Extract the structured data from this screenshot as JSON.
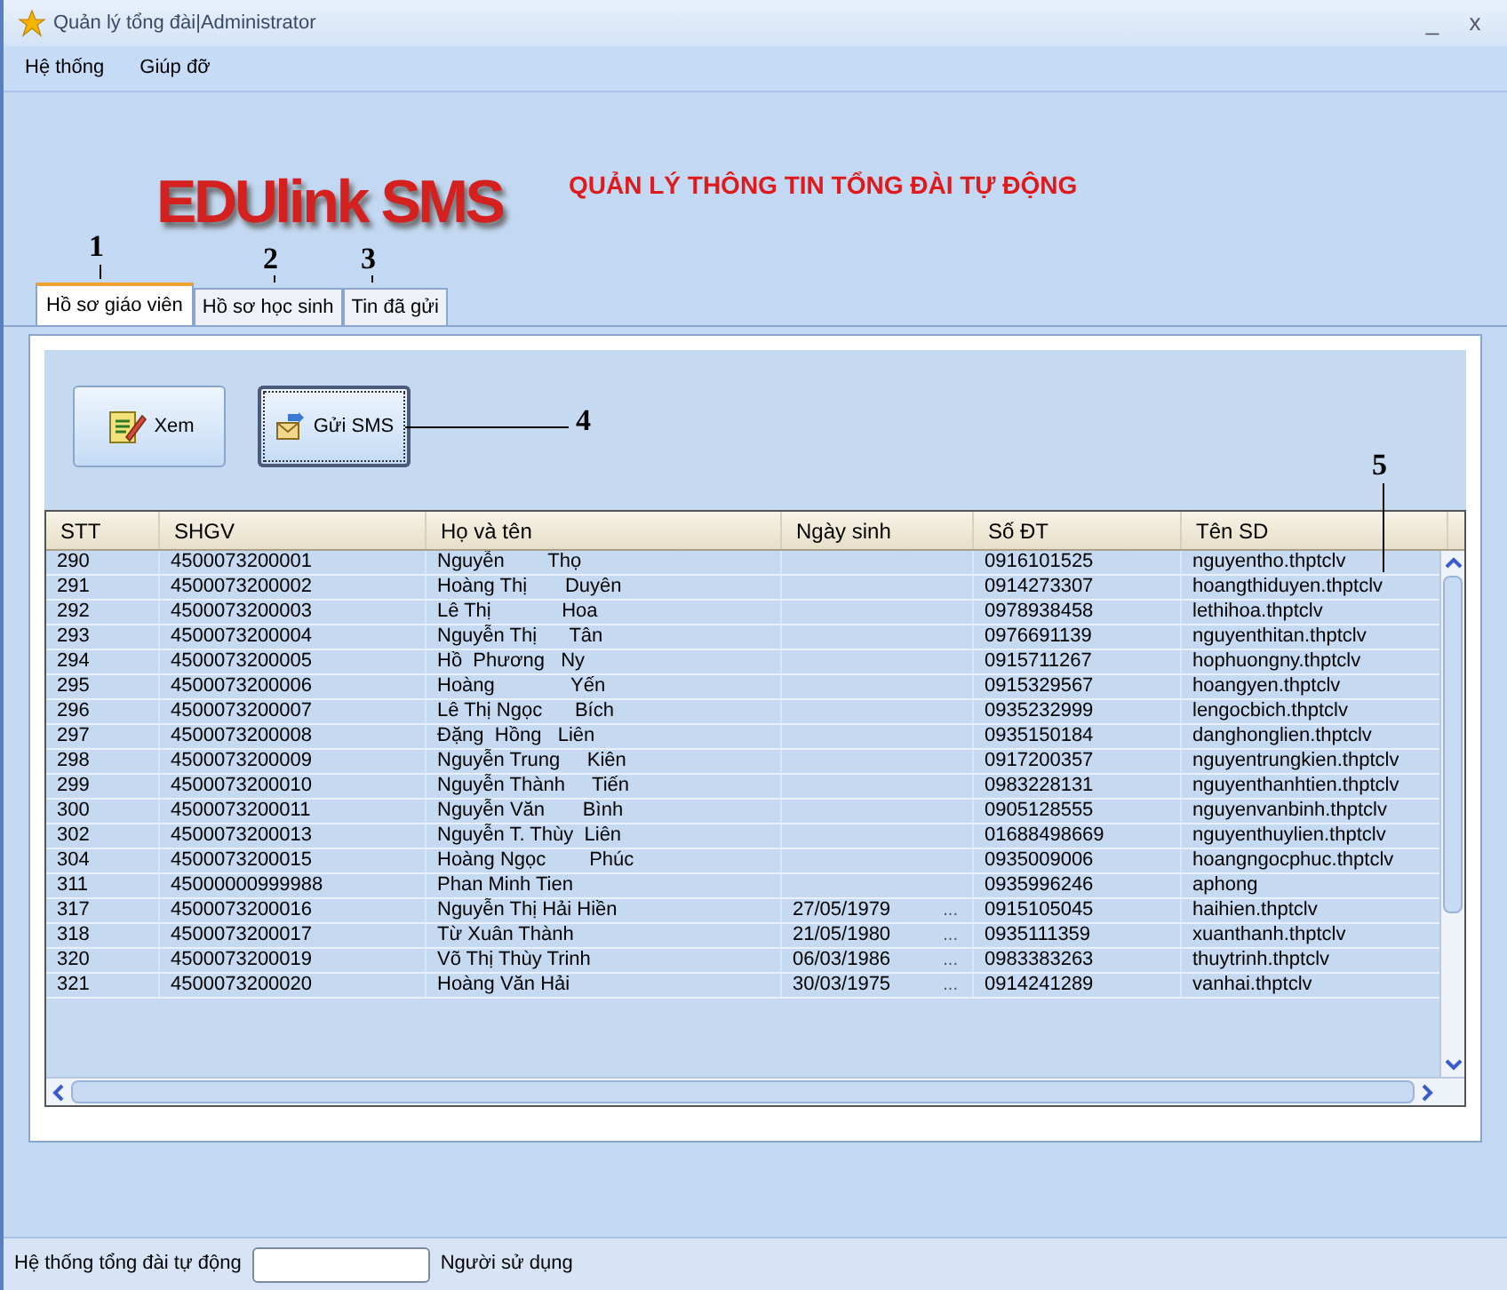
{
  "window": {
    "title": "Quản lý tổng đài|Administrator",
    "controls": [
      "_",
      "x"
    ]
  },
  "menu": [
    "Hệ thống",
    "Giúp đỡ"
  ],
  "header": {
    "logo": "EDUlink SMS",
    "title": "QUẢN LÝ THÔNG TIN TỔNG ĐÀI TỰ ĐỘNG"
  },
  "tabs": [
    {
      "label": "Hồ sơ giáo viên",
      "selected": true
    },
    {
      "label": "Hồ sơ học sinh",
      "selected": false
    },
    {
      "label": "Tin đã gửi",
      "selected": false
    }
  ],
  "toolbar": [
    {
      "label": "Xem",
      "kind": "view",
      "focused": false
    },
    {
      "label": "Gửi SMS",
      "kind": "send",
      "focused": true
    }
  ],
  "table": {
    "columns": [
      "STT",
      "SHGV",
      "Họ và tên",
      "Ngày sinh",
      "Số ĐT",
      "Tên SD"
    ],
    "rows": [
      [
        "290",
        "4500073200001",
        "Nguyễn        Thọ",
        "",
        "0916101525",
        "nguyentho.thptclv"
      ],
      [
        "291",
        "4500073200002",
        "Hoàng Thị       Duyên",
        "",
        "0914273307",
        "hoangthiduyen.thptclv"
      ],
      [
        "292",
        "4500073200003",
        "Lê Thị             Hoa",
        "",
        "0978938458",
        "lethihoa.thptclv"
      ],
      [
        "293",
        "4500073200004",
        "Nguyễn Thị      Tân",
        "",
        "0976691139",
        "nguyenthitan.thptclv"
      ],
      [
        "294",
        "4500073200005",
        "Hồ  Phương   Ny",
        "",
        "0915711267",
        "hophuongny.thptclv"
      ],
      [
        "295",
        "4500073200006",
        "Hoàng              Yến",
        "",
        "0915329567",
        "hoangyen.thptclv"
      ],
      [
        "296",
        "4500073200007",
        "Lê Thị Ngọc      Bích",
        "",
        "0935232999",
        "lengocbich.thptclv"
      ],
      [
        "297",
        "4500073200008",
        "Đặng  Hồng   Liên",
        "",
        "0935150184",
        "danghonglien.thptclv"
      ],
      [
        "298",
        "4500073200009",
        "Nguyễn Trung     Kiên",
        "",
        "0917200357",
        "nguyentrungkien.thptclv"
      ],
      [
        "299",
        "4500073200010",
        "Nguyễn Thành     Tiến",
        "",
        "0983228131",
        "nguyenthanhtien.thptclv"
      ],
      [
        "300",
        "4500073200011",
        "Nguyễn Văn       Bình",
        "",
        "0905128555",
        "nguyenvanbinh.thptclv"
      ],
      [
        "302",
        "4500073200013",
        "Nguyễn T. Thùy  Liên",
        "",
        "01688498669",
        "nguyenthuylien.thptclv"
      ],
      [
        "304",
        "4500073200015",
        "Hoàng Ngọc        Phúc",
        "",
        "0935009006",
        "hoangngocphuc.thptclv"
      ],
      [
        "311",
        "45000000999988",
        "Phan Minh Tien",
        "",
        "0935996246",
        "aphong"
      ],
      [
        "317",
        "4500073200016",
        "Nguyễn Thị Hải Hiền",
        {
          "date": "27/05/1979",
          "picker": "..."
        },
        "0915105045",
        "haihien.thptclv"
      ],
      [
        "318",
        "4500073200017",
        "Từ Xuân Thành",
        {
          "date": "21/05/1980",
          "picker": "..."
        },
        "0935111359",
        "xuanthanh.thptclv"
      ],
      [
        "320",
        "4500073200019",
        "Võ Thị Thùy Trinh",
        {
          "date": "06/03/1986",
          "picker": "..."
        },
        "0983383263",
        "thuytrinh.thptclv"
      ],
      [
        "321",
        "4500073200020",
        "Hoàng Văn Hải",
        {
          "date": "30/03/1975",
          "picker": "..."
        },
        "0914241289",
        "vanhai.thptclv"
      ]
    ]
  },
  "annotations": [
    "1",
    "2",
    "3",
    "4",
    "5"
  ],
  "status_bar": {
    "label": "Hệ thống tổng đài tự động",
    "user_label": "Người sử dụng"
  }
}
